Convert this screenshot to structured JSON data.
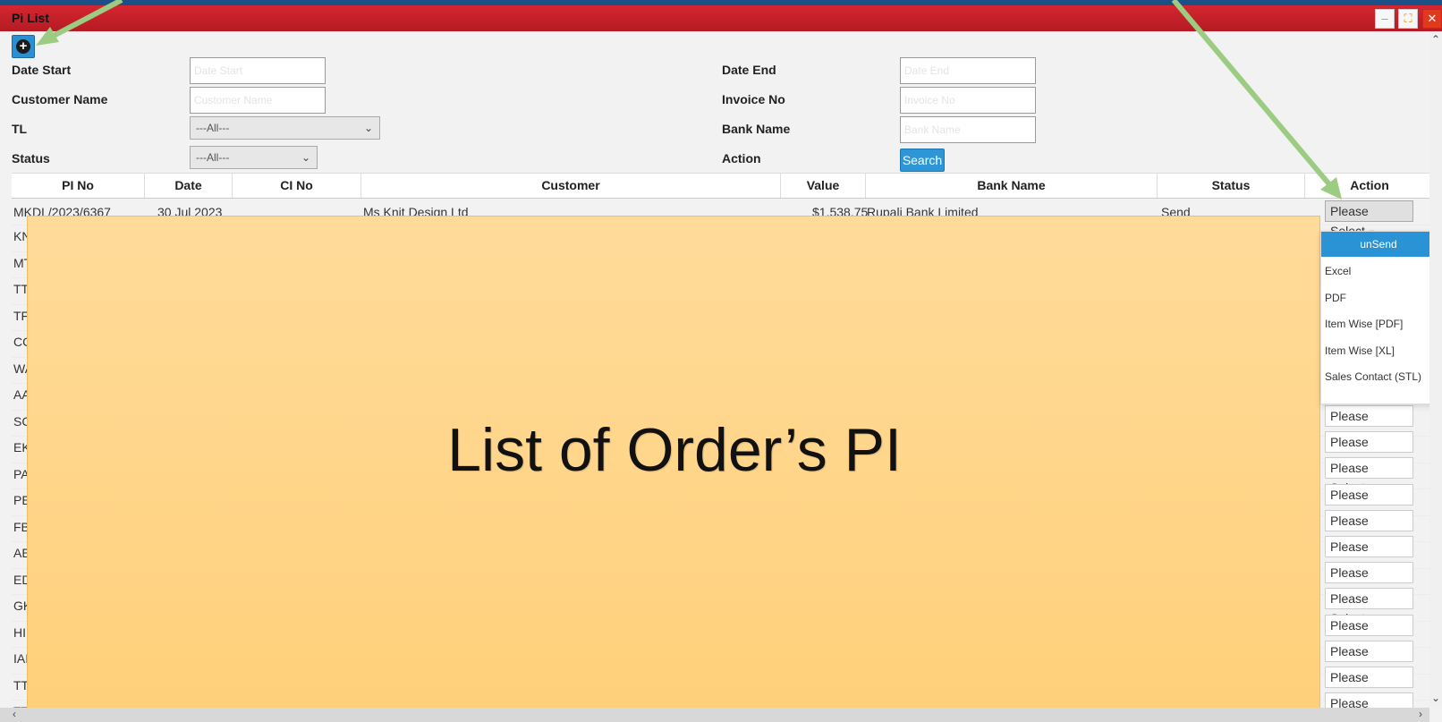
{
  "window": {
    "title": "Pi List"
  },
  "window_controls": {
    "minimize": "–",
    "maximize": "⛶",
    "close": "✕"
  },
  "toolbar": {
    "add_symbol": "+"
  },
  "filters": {
    "date_start_label": "Date Start",
    "date_start_placeholder": "Date Start",
    "date_end_label": "Date End",
    "date_end_placeholder": "Date End",
    "customer_name_label": "Customer Name",
    "customer_name_placeholder": "Customer Name",
    "invoice_no_label": "Invoice No",
    "invoice_no_placeholder": "Invoice No",
    "tl_label": "TL",
    "tl_value": "---All---",
    "bank_name_label": "Bank Name",
    "bank_name_placeholder": "Bank Name",
    "status_label": "Status",
    "status_value": "---All---",
    "action_label": "Action",
    "search_button": "Search"
  },
  "table": {
    "columns": [
      "PI No",
      "Date",
      "CI No",
      "Customer",
      "Value",
      "Bank Name",
      "Status",
      "Action"
    ],
    "first_row": {
      "pi_no": "MKDL/2023/6367",
      "date": "30 Jul 2023",
      "customer": "Ms Knit Design Ltd",
      "value": "$1,538.75",
      "bank": "Rupali Bank Limited",
      "status": "Send"
    },
    "row_prefixes": [
      "KN",
      "MT",
      "TT",
      "TF",
      "CC",
      "WA",
      "AA",
      "SC",
      "EK",
      "PA",
      "PE",
      "FB",
      "AE",
      "ED",
      "GK",
      "HI",
      "IAI",
      "TT",
      "TT"
    ],
    "action_select_label": "Please Select"
  },
  "action_dropdown": {
    "items": [
      "unSend",
      "Excel",
      "PDF",
      "Item Wise [PDF]",
      "Item Wise [XL]",
      "Sales Contact (STL)"
    ]
  },
  "overlay": {
    "caption": "List of Order’s PI"
  },
  "colors": {
    "titlebar": "#c8202b",
    "accent": "#2a93d5",
    "overlay": "#ffd68a",
    "annotation_arrow": "#9ccc82"
  }
}
